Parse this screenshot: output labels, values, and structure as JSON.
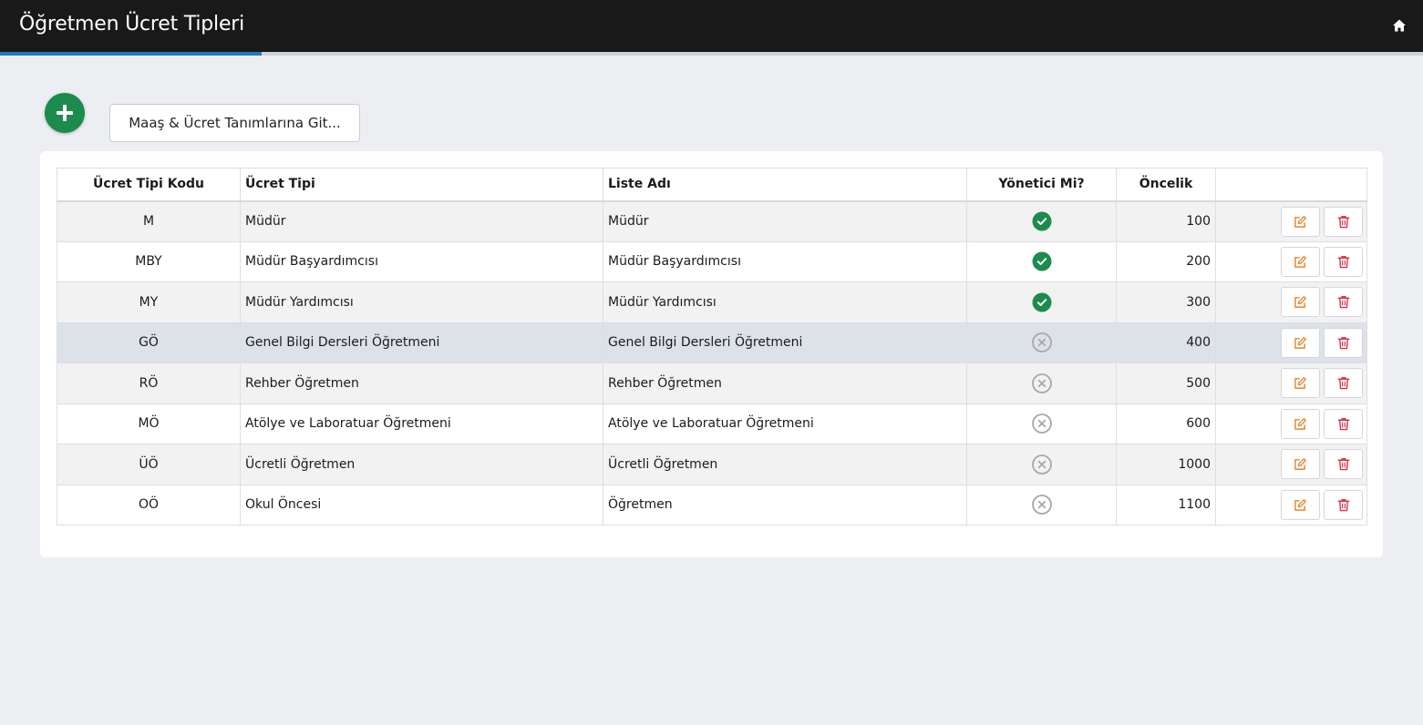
{
  "header": {
    "title": "Öğretmen Ücret Tipleri",
    "home_icon": "home-icon",
    "progress_percent": 18.4
  },
  "toolbar": {
    "add_icon": "plus-icon",
    "add_color": "#1d8b4e",
    "goto_label": "Maaş & Ücret Tanımlarına Git..."
  },
  "table": {
    "columns": [
      "Ücret Tipi Kodu",
      "Ücret Tipi",
      "Liste Adı",
      "Yönetici Mi?",
      "Öncelik",
      ""
    ],
    "rows": [
      {
        "code": "M",
        "type": "Müdür",
        "list_name": "Müdür",
        "is_manager": true,
        "priority": "100"
      },
      {
        "code": "MBY",
        "type": "Müdür Başyardımcısı",
        "list_name": "Müdür Başyardımcısı",
        "is_manager": true,
        "priority": "200"
      },
      {
        "code": "MY",
        "type": "Müdür Yardımcısı",
        "list_name": "Müdür Yardımcısı",
        "is_manager": true,
        "priority": "300"
      },
      {
        "code": "GÖ",
        "type": "Genel Bilgi Dersleri Öğretmeni",
        "list_name": "Genel Bilgi Dersleri Öğretmeni",
        "is_manager": false,
        "priority": "400"
      },
      {
        "code": "RÖ",
        "type": "Rehber Öğretmen",
        "list_name": "Rehber Öğretmen",
        "is_manager": false,
        "priority": "500"
      },
      {
        "code": "MÖ",
        "type": "Atölye ve Laboratuar Öğretmeni",
        "list_name": "Atölye ve Laboratuar Öğretmeni",
        "is_manager": false,
        "priority": "600"
      },
      {
        "code": "ÜÖ",
        "type": "Ücretli Öğretmen",
        "list_name": "Ücretli Öğretmen",
        "is_manager": false,
        "priority": "1000"
      },
      {
        "code": "OÖ",
        "type": "Okul Öncesi",
        "list_name": "Öğretmen",
        "is_manager": false,
        "priority": "1100"
      }
    ],
    "highlighted_row": 3,
    "icons": {
      "yes": "check-circle-icon",
      "no": "x-circle-icon",
      "edit": "edit-icon",
      "delete": "trash-icon"
    },
    "colors": {
      "yes": "#1d8b4e",
      "no": "#a8a8a8",
      "edit": "#e8822e",
      "delete": "#d9344a"
    }
  }
}
